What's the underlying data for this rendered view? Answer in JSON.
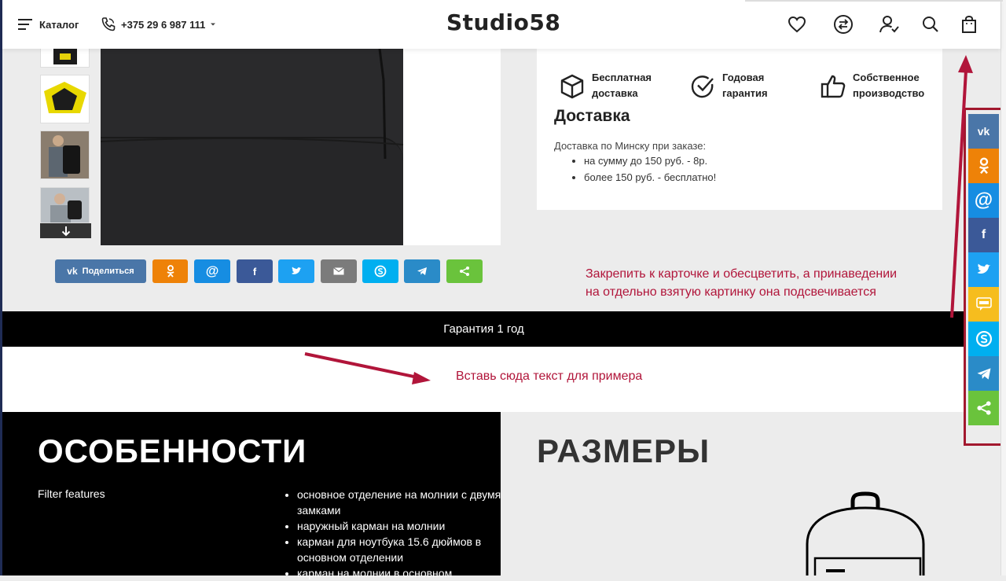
{
  "header": {
    "catalog_label": "Каталог",
    "phone": "+375 29 6 987 111",
    "logo": "Studio58"
  },
  "product": {
    "share_button_label": "Поделиться"
  },
  "features_row": [
    {
      "icon": "box-icon",
      "line1": "Бесплатная",
      "line2": "доставка"
    },
    {
      "icon": "check-circle-icon",
      "line1": "Годовая",
      "line2": "гарантия"
    },
    {
      "icon": "thumbs-up-icon",
      "line1": "Собственное",
      "line2": "производство"
    }
  ],
  "delivery": {
    "title": "Доставка",
    "intro": "Доставка по Минску при заказе:",
    "items": [
      "на сумму до 150 руб. - 8р.",
      "более 150 руб. - бесплатно!"
    ]
  },
  "annotations": {
    "sidebar_note_line1": "Закрепить к карточке и обесцветить, а принаведении",
    "sidebar_note_line2": "на отдельно взятую картинку она подсвечивается",
    "insert_note": "Вставь сюда текст для примера"
  },
  "guarantee_bar": "Гарантия 1 год",
  "features_section": {
    "title": "ОСОБЕННОСТИ",
    "filter_label": "Filter features",
    "items": [
      "основное отделение на молнии с двумя замками",
      "наружный карман на молнии",
      "карман для ноутбука 15.6 дюймов в основном отделении",
      "карман на молнии в основном"
    ]
  },
  "sizes_section": {
    "title": "РАЗМЕРЫ"
  },
  "share_colors": {
    "vk": "#4a76a8",
    "ok": "#ee8208",
    "mail": "#168de2",
    "facebook": "#3b5998",
    "twitter": "#1da1f2",
    "email": "#7b7b7b",
    "skype": "#00aff0",
    "telegram": "#2a8bc8",
    "share": "#6ac33c",
    "sms": "#f6bd1e"
  }
}
